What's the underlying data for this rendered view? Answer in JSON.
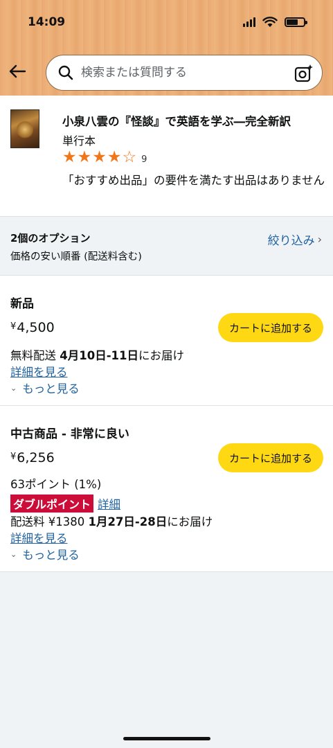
{
  "status_bar": {
    "time": "14:09"
  },
  "search": {
    "placeholder": "検索または質問する"
  },
  "product": {
    "title": "小泉八雲の『怪談』で英語を学ぶ―完全新訳",
    "format": "単行本",
    "rating_stars": 4,
    "rating_count": "9",
    "note": "「おすすめ出品」の要件を満たす出品はありません"
  },
  "options": {
    "title": "2個のオプション",
    "sort": "価格の安い順番 (配送料含む)",
    "filter_label": "絞り込み",
    "filter_chevron": "›"
  },
  "offers": [
    {
      "condition": "新品",
      "currency": "¥",
      "price": "4,500",
      "cart_label": "カートに追加する",
      "shipping_prefix": "無料配送 ",
      "shipping_dates": "4月10日-11日",
      "shipping_suffix": "にお届け",
      "details_label": "詳細を見る",
      "more_label": "もっと見る"
    },
    {
      "condition": "中古商品 - 非常に良い",
      "currency": "¥",
      "price": "6,256",
      "cart_label": "カートに追加する",
      "points": "63ポイント (1%)",
      "badge": "ダブルポイント",
      "badge_link": "詳細",
      "shipping_prefix": "配送料 ¥1380 ",
      "shipping_dates": "1月27日-28日",
      "shipping_suffix": "にお届け",
      "details_label": "詳細を見る",
      "more_label": "もっと見る"
    }
  ],
  "colors": {
    "header": "#eeb47c",
    "cart_button": "#ffd814",
    "link": "#2162a1",
    "star": "#f0761a",
    "badge": "#cc0c39"
  }
}
